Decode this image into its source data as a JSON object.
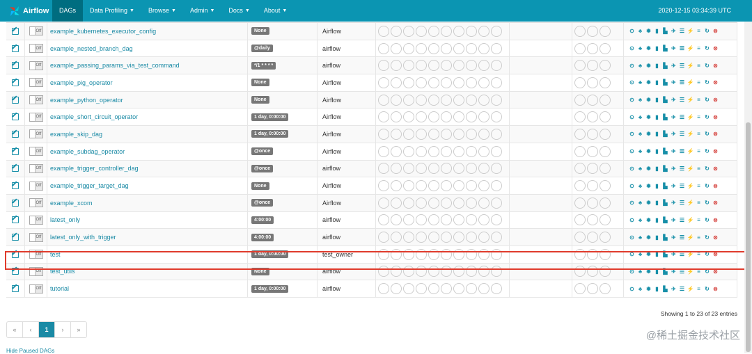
{
  "app": {
    "brand": "Airflow",
    "clock": "2020-12-15 03:34:39 UTC"
  },
  "nav": [
    {
      "label": "DAGs",
      "active": true,
      "caret": false
    },
    {
      "label": "Data Profiling",
      "active": false,
      "caret": true
    },
    {
      "label": "Browse",
      "active": false,
      "caret": true
    },
    {
      "label": "Admin",
      "active": false,
      "caret": true
    },
    {
      "label": "Docs",
      "active": false,
      "caret": true
    },
    {
      "label": "About",
      "active": false,
      "caret": true
    }
  ],
  "toggle_label": "Off",
  "rows": [
    {
      "name": "example_kubernetes_executor_config",
      "schedule": "None",
      "owner": "Airflow"
    },
    {
      "name": "example_nested_branch_dag",
      "schedule": "@daily",
      "owner": "airflow"
    },
    {
      "name": "example_passing_params_via_test_command",
      "schedule": "*/1 * * * *",
      "owner": "airflow"
    },
    {
      "name": "example_pig_operator",
      "schedule": "None",
      "owner": "Airflow"
    },
    {
      "name": "example_python_operator",
      "schedule": "None",
      "owner": "Airflow"
    },
    {
      "name": "example_short_circuit_operator",
      "schedule": "1 day, 0:00:00",
      "owner": "Airflow"
    },
    {
      "name": "example_skip_dag",
      "schedule": "1 day, 0:00:00",
      "owner": "Airflow"
    },
    {
      "name": "example_subdag_operator",
      "schedule": "@once",
      "owner": "Airflow"
    },
    {
      "name": "example_trigger_controller_dag",
      "schedule": "@once",
      "owner": "airflow"
    },
    {
      "name": "example_trigger_target_dag",
      "schedule": "None",
      "owner": "Airflow"
    },
    {
      "name": "example_xcom",
      "schedule": "@once",
      "owner": "Airflow"
    },
    {
      "name": "latest_only",
      "schedule": "4:00:00",
      "owner": "airflow"
    },
    {
      "name": "latest_only_with_trigger",
      "schedule": "4:00:00",
      "owner": "airflow"
    },
    {
      "name": "test",
      "schedule": "1 day, 0:00:00",
      "owner": "test_owner"
    },
    {
      "name": "test_utils",
      "schedule": "None",
      "owner": "airflow"
    },
    {
      "name": "tutorial",
      "schedule": "1 day, 0:00:00",
      "owner": "airflow"
    }
  ],
  "link_icons": [
    {
      "name": "trigger-dag-icon",
      "glyph": "⊙"
    },
    {
      "name": "tree-view-icon",
      "glyph": "♣"
    },
    {
      "name": "graph-view-icon",
      "glyph": "✹"
    },
    {
      "name": "duration-chart-icon",
      "glyph": "▮"
    },
    {
      "name": "tries-icon",
      "glyph": "▙"
    },
    {
      "name": "landing-times-icon",
      "glyph": "✈"
    },
    {
      "name": "gantt-icon",
      "glyph": "☰"
    },
    {
      "name": "code-view-icon",
      "glyph": "⚡"
    },
    {
      "name": "logs-icon",
      "glyph": "≡"
    },
    {
      "name": "refresh-icon",
      "glyph": "↻"
    },
    {
      "name": "delete-icon",
      "glyph": "⊗"
    }
  ],
  "footer": {
    "info": "Showing 1 to 23 of 23 entries",
    "pager": [
      "«",
      "‹",
      "1",
      "›",
      "»"
    ],
    "hide_paused": "Hide Paused DAGs"
  },
  "watermark": "@稀土掘金技术社区",
  "colors": {
    "navbar": "#0b95b2",
    "link": "#1a8aa5",
    "highlight": "#e03b2c"
  }
}
